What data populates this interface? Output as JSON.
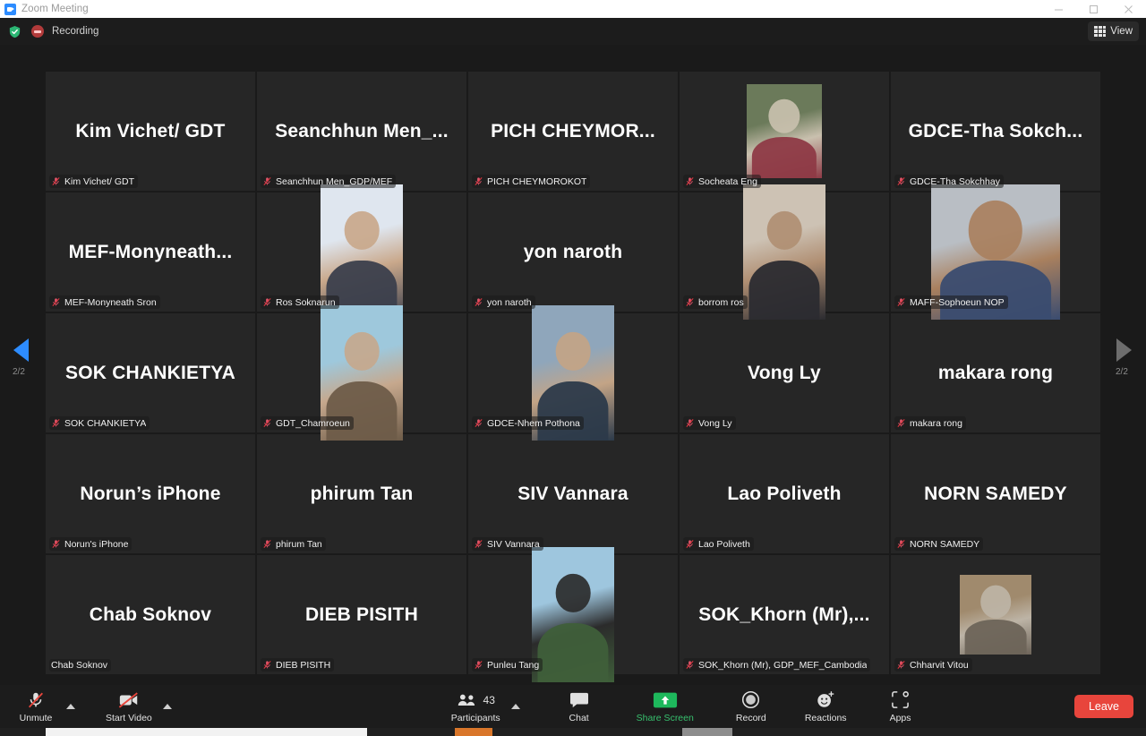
{
  "window": {
    "title": "Zoom Meeting",
    "icon": "zoom-logo-icon",
    "minimize_label": "Minimize",
    "maximize_label": "Maximize",
    "close_label": "Close"
  },
  "header": {
    "encryption_icon": "green-shield-icon",
    "recording_icon": "recording-indicator-icon",
    "recording_label": "Recording",
    "view_label": "View",
    "view_icon": "grid-view-icon"
  },
  "gallery": {
    "left_arrow_icon": "chevron-left-page-icon",
    "right_arrow_icon": "chevron-right-page-icon",
    "page_indicator_left": "2/2",
    "page_indicator_right": "2/2",
    "mic_muted_icon": "mic-muted-icon",
    "tiles": [
      {
        "display": "Kim Vichet/ GDT",
        "name": "Kim Vichet/ GDT",
        "video": false,
        "muted": true
      },
      {
        "display": "Seanchhun  Men_...",
        "name": "Seanchhun Men_GDP/MEF",
        "video": false,
        "muted": true
      },
      {
        "display": "PICH  CHEYMOR...",
        "name": "PICH CHEYMOROKOT",
        "video": false,
        "muted": true
      },
      {
        "display": "",
        "name": "Socheata Eng",
        "video": true,
        "video_style": "small",
        "video_colors": [
          "#6b7a5a",
          "#8e3a46",
          "#c9c0ae"
        ],
        "muted": true
      },
      {
        "display": "GDCE-Tha  Sokch...",
        "name": "GDCE-Tha Sokchhay",
        "video": false,
        "muted": true
      },
      {
        "display": "MEF-Monyneath...",
        "name": "MEF-Monyneath Sron",
        "video": false,
        "muted": true
      },
      {
        "display": "",
        "name": "Ros Soknarun",
        "video": true,
        "video_style": "portrait",
        "video_colors": [
          "#dfe6ef",
          "#3b3f4c",
          "#c9a88b"
        ],
        "muted": true
      },
      {
        "display": "yon naroth",
        "name": "yon naroth",
        "video": false,
        "muted": true
      },
      {
        "display": "",
        "name": "borrom ros",
        "video": true,
        "video_style": "portrait",
        "video_colors": [
          "#cdc2b4",
          "#2b2b30",
          "#b08f73"
        ],
        "muted": true
      },
      {
        "display": "",
        "name": "MAFF-Sophoeun NOP",
        "video": true,
        "video_style": "wide",
        "video_colors": [
          "#b9bec4",
          "#3a4c70",
          "#a9805e"
        ],
        "muted": true
      },
      {
        "display": "SOK CHANKIETYA",
        "name": "SOK CHANKIETYA",
        "video": false,
        "muted": true
      },
      {
        "display": "",
        "name": "GDT_Chamroeun",
        "video": true,
        "video_style": "portrait",
        "video_colors": [
          "#9ec8dc",
          "#6e5c49",
          "#c6a88d"
        ],
        "muted": true
      },
      {
        "display": "",
        "name": "GDCE-Nhem Pothona",
        "video": true,
        "video_style": "portrait",
        "video_colors": [
          "#8fa6bb",
          "#2c3a4a",
          "#c3a486"
        ],
        "muted": true
      },
      {
        "display": "Vong Ly",
        "name": "Vong Ly",
        "video": false,
        "muted": true
      },
      {
        "display": "makara rong",
        "name": "makara rong",
        "video": false,
        "muted": true
      },
      {
        "display": "Norun’s iPhone",
        "name": "Norun's iPhone",
        "video": false,
        "muted": true
      },
      {
        "display": "phirum Tan",
        "name": "phirum Tan",
        "video": false,
        "muted": true
      },
      {
        "display": "SIV Vannara",
        "name": "SIV Vannara",
        "video": false,
        "muted": true
      },
      {
        "display": "Lao Poliveth",
        "name": "Lao Poliveth",
        "video": false,
        "muted": true
      },
      {
        "display": "NORN SAMEDY",
        "name": "NORN SAMEDY",
        "video": false,
        "muted": true
      },
      {
        "display": "Chab Soknov",
        "name": "Chab Soknov",
        "video": false,
        "muted": false
      },
      {
        "display": "DIEB PISITH",
        "name": "DIEB PISITH",
        "video": false,
        "muted": true
      },
      {
        "display": "",
        "name": "Punleu Tang",
        "video": true,
        "video_style": "portrait",
        "video_colors": [
          "#9ec6de",
          "#3f5f3a",
          "#2b2b2b"
        ],
        "muted": true
      },
      {
        "display": "SOK_Khorn  (Mr),...",
        "name": "SOK_Khorn (Mr), GDP_MEF_Cambodia",
        "video": false,
        "muted": true
      },
      {
        "display": "",
        "name": "Chharvit Vitou",
        "video": true,
        "video_style": "tiny",
        "video_colors": [
          "#a08a6d",
          "#6d6459",
          "#bdb4a6"
        ],
        "muted": true
      }
    ]
  },
  "toolbar": {
    "audio_label": "Unmute",
    "audio_icon": "mic-muted-icon",
    "audio_caret_icon": "chevron-up-icon",
    "video_label": "Start Video",
    "video_icon": "camera-off-icon",
    "video_caret_icon": "chevron-up-icon",
    "participants_label": "Participants",
    "participants_icon": "participants-icon",
    "participants_count": "43",
    "participants_caret_icon": "chevron-up-icon",
    "chat_label": "Chat",
    "chat_icon": "chat-bubble-icon",
    "share_label": "Share Screen",
    "share_icon": "share-screen-icon",
    "record_label": "Record",
    "record_icon": "record-circle-icon",
    "reactions_label": "Reactions",
    "reactions_icon": "reactions-smiley-icon",
    "apps_label": "Apps",
    "apps_icon": "apps-icon",
    "leave_label": "Leave"
  },
  "colors": {
    "accent_blue": "#2d8cff",
    "share_green": "#37c16e",
    "leave_red": "#e8453c",
    "recording_red": "#b23b3b",
    "tile_bg": "#262626",
    "stage_bg": "#1a1a1a"
  }
}
